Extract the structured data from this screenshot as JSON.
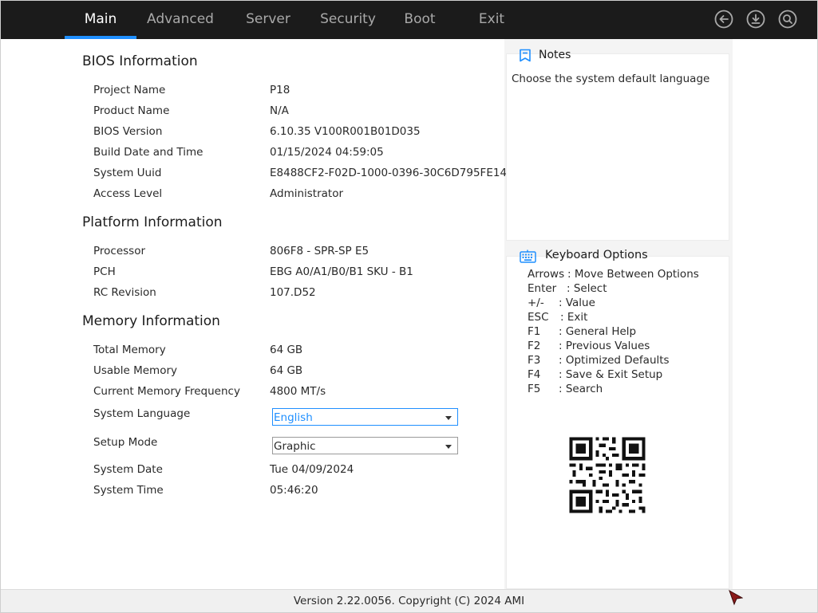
{
  "tabs": [
    {
      "label": "Main",
      "active": true
    },
    {
      "label": "Advanced",
      "active": false
    },
    {
      "label": "Server",
      "active": false
    },
    {
      "label": "Security",
      "active": false
    },
    {
      "label": "Boot",
      "active": false
    },
    {
      "label": "Exit",
      "active": false
    }
  ],
  "top_icons": [
    "back-arrow-icon",
    "download-icon",
    "search-icon"
  ],
  "sections": {
    "bios": {
      "title": "BIOS Information",
      "rows": [
        {
          "label": "Project Name",
          "value": "P18"
        },
        {
          "label": "Product Name",
          "value": "N/A"
        },
        {
          "label": "BIOS Version",
          "value": "6.10.35 V100R001B01D035"
        },
        {
          "label": "Build Date and Time",
          "value": "01/15/2024 04:59:05"
        },
        {
          "label": "System Uuid",
          "value": "E8488CF2-F02D-1000-0396-30C6D795FE14"
        },
        {
          "label": "Access Level",
          "value": "Administrator"
        }
      ]
    },
    "platform": {
      "title": "Platform Information",
      "rows": [
        {
          "label": "Processor",
          "value": "806F8 - SPR-SP E5"
        },
        {
          "label": "PCH",
          "value": "EBG A0/A1/B0/B1 SKU - B1"
        },
        {
          "label": "RC Revision",
          "value": "107.D52"
        }
      ]
    },
    "memory": {
      "title": "Memory Information",
      "rows": [
        {
          "label": "Total Memory",
          "value": "64 GB"
        },
        {
          "label": "Usable Memory",
          "value": "64 GB"
        },
        {
          "label": "Current Memory Frequency",
          "value": "4800 MT/s"
        }
      ]
    }
  },
  "settings": {
    "language": {
      "label": "System Language",
      "value": "English"
    },
    "setup_mode": {
      "label": "Setup Mode",
      "value": "Graphic"
    },
    "date": {
      "label": "System Date",
      "value": "Tue 04/09/2024"
    },
    "time": {
      "label": "System Time",
      "value": "05:46:20"
    }
  },
  "notes": {
    "title": "Notes",
    "text": "Choose the system default language"
  },
  "keyboard": {
    "title": "Keyboard Options",
    "items": [
      {
        "key": "Arrows",
        "desc": ": Move Between Options"
      },
      {
        "key": "Enter",
        "desc": ": Select"
      },
      {
        "key": "+/-",
        "desc": ": Value"
      },
      {
        "key": "ESC",
        "desc": ": Exit"
      },
      {
        "key": "F1",
        "desc": ": General Help"
      },
      {
        "key": "F2",
        "desc": ": Previous Values"
      },
      {
        "key": "F3",
        "desc": ": Optimized Defaults"
      },
      {
        "key": "F4",
        "desc": ": Save & Exit Setup"
      },
      {
        "key": "F5",
        "desc": ": Search"
      }
    ]
  },
  "footer": {
    "text": "Version 2.22.0056. Copyright (C) 2024 AMI"
  },
  "colors": {
    "accent": "#1f8fff",
    "topbar": "#1b1b1b"
  }
}
